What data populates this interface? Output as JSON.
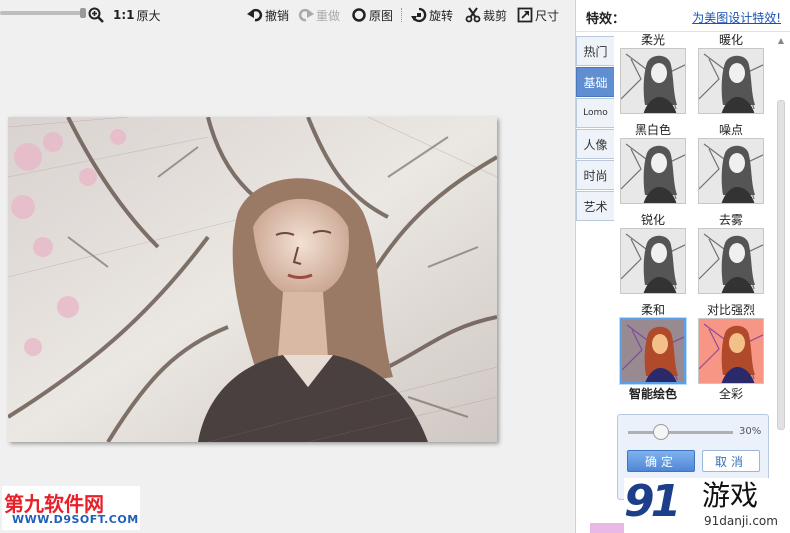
{
  "toolbar": {
    "zoom_ratio": "1:1",
    "original_size": "原大",
    "undo": "撤销",
    "redo": "重做",
    "original": "原图",
    "rotate": "旋转",
    "crop": "裁剪",
    "size": "尺寸"
  },
  "panel": {
    "title": "特效：",
    "link": "为美图设计特效!",
    "tabs": [
      "热门",
      "基础",
      "Lomo",
      "人像",
      "时尚",
      "艺术"
    ],
    "active_tab": "基础",
    "effects": [
      {
        "label": "柔光",
        "icon": "portrait-sketch-thumb"
      },
      {
        "label": "暖化",
        "icon": "portrait-sketch-thumb"
      },
      {
        "label": "黑白色",
        "icon": "portrait-sketch-thumb"
      },
      {
        "label": "噪点",
        "icon": "portrait-sketch-thumb"
      },
      {
        "label": "锐化",
        "icon": "portrait-sketch-thumb"
      },
      {
        "label": "去雾",
        "icon": "portrait-sketch-thumb"
      },
      {
        "label": "柔和",
        "icon": "portrait-color-thumb"
      },
      {
        "label": "对比强烈",
        "icon": "portrait-color-thumb"
      }
    ],
    "selected_caption": "智能绘色",
    "other_caption": "全彩"
  },
  "strength": {
    "value_label": "30%",
    "value": 0.3,
    "ok": "确定",
    "cancel": "取消"
  },
  "watermarks": {
    "left_title": "第九软件网",
    "left_url": "WWW.D9SOFT.COM",
    "right_logo": "91",
    "right_title": "游戏",
    "right_url": "91danji.com"
  },
  "colors": {
    "accent": "#5f8fd1",
    "link": "#1a52b4",
    "selected_border": "#5aa0e8"
  }
}
